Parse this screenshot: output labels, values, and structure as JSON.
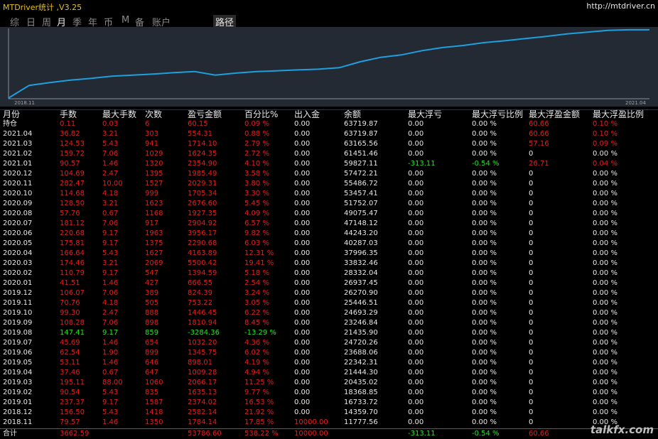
{
  "titlebar": {
    "title": "MTDriver统计 ,V3.25",
    "url": "http://mtdriver.cn"
  },
  "tabs": [
    {
      "label": "综",
      "active": false
    },
    {
      "label": "日",
      "active": false
    },
    {
      "label": "周",
      "active": false
    },
    {
      "label": "月",
      "active": true
    },
    {
      "label": "季",
      "active": false
    },
    {
      "label": "年",
      "active": false
    },
    {
      "label": "币",
      "active": false
    },
    {
      "label": "M",
      "active": false
    },
    {
      "label": "备",
      "active": false
    },
    {
      "label": "账户",
      "active": false
    }
  ],
  "path_tab": "路径",
  "chart_data": {
    "type": "line",
    "x_start_label": "2018.11",
    "x_end_label": "2021.04",
    "line_color": "#1ea0e0",
    "series": [
      {
        "values": [
          0,
          11777.56,
          14359.7,
          16733.72,
          18368.85,
          20435.02,
          21444.3,
          22342.31,
          23688.06,
          24720.26,
          21435.9,
          23246.84,
          24693.29,
          25446.51,
          26270.9,
          26937.45,
          28332.04,
          33832.46,
          37996.35,
          40287.03,
          44243.2,
          47148.12,
          49075.47,
          51752.07,
          53457.41,
          55486.72,
          57472.21,
          59827.11,
          61451.46,
          63165.56,
          63719.87,
          63719.87
        ]
      }
    ]
  },
  "table": {
    "headers": [
      "月份",
      "手数",
      "最大手数",
      "次数",
      "盈亏金额",
      "百分比%",
      "出入金",
      "余额",
      "最大浮亏",
      "最大浮亏比例",
      "最大浮盈金额",
      "最大浮盈比例"
    ],
    "rows": [
      [
        "持仓",
        "0.11",
        "0.03",
        "6",
        "60.15",
        "0.09 %",
        "0.00",
        "63719.87",
        "0.00",
        "0.00 %",
        "60.66",
        "0.10 %"
      ],
      [
        "2021.04",
        "36.82",
        "3.21",
        "303",
        "554.31",
        "0.88 %",
        "0.00",
        "63719.87",
        "0.00",
        "0.00 %",
        "60.66",
        "0.10 %"
      ],
      [
        "2021.03",
        "124.53",
        "5.43",
        "941",
        "1714.10",
        "2.79 %",
        "0.00",
        "63165.56",
        "0.00",
        "0.00 %",
        "57.16",
        "0.09 %"
      ],
      [
        "2021.02",
        "159.72",
        "7.06",
        "1029",
        "1624.35",
        "2.72 %",
        "0.00",
        "61451.46",
        "0.00",
        "0.00 %",
        "0",
        "0.00 %"
      ],
      [
        "2021.01",
        "90.57",
        "1.46",
        "1320",
        "2354.90",
        "4.10 %",
        "0.00",
        "59827.11",
        "-313.11",
        "-0.54 %",
        "26.71",
        "0.04 %"
      ],
      [
        "2020.12",
        "104.69",
        "2.47",
        "1395",
        "1985.49",
        "3.58 %",
        "0.00",
        "57472.21",
        "0.00",
        "0.00 %",
        "0",
        "0.00 %"
      ],
      [
        "2020.11",
        "282.47",
        "10.00",
        "1527",
        "2029.31",
        "3.80 %",
        "0.00",
        "55486.72",
        "0.00",
        "0.00 %",
        "0",
        "0.00 %"
      ],
      [
        "2020.10",
        "114.68",
        "4.18",
        "999",
        "1705.34",
        "3.30 %",
        "0.00",
        "53457.41",
        "0.00",
        "0.00 %",
        "0",
        "0.00 %"
      ],
      [
        "2020.09",
        "128.50",
        "3.21",
        "1623",
        "2676.60",
        "5.45 %",
        "0.00",
        "51752.07",
        "0.00",
        "0.00 %",
        "0",
        "0.00 %"
      ],
      [
        "2020.08",
        "57.76",
        "0.67",
        "1168",
        "1927.35",
        "4.09 %",
        "0.00",
        "49075.47",
        "0.00",
        "0.00 %",
        "0",
        "0.00 %"
      ],
      [
        "2020.07",
        "181.12",
        "7.06",
        "917",
        "2904.92",
        "6.57 %",
        "0.00",
        "47148.12",
        "0.00",
        "0.00 %",
        "0",
        "0.00 %"
      ],
      [
        "2020.06",
        "220.68",
        "9.17",
        "1963",
        "3956.17",
        "9.82 %",
        "0.00",
        "44243.20",
        "0.00",
        "0.00 %",
        "0",
        "0.00 %"
      ],
      [
        "2020.05",
        "175.81",
        "9.17",
        "1375",
        "2290.68",
        "6.03 %",
        "0.00",
        "40287.03",
        "0.00",
        "0.00 %",
        "0",
        "0.00 %"
      ],
      [
        "2020.04",
        "166.64",
        "5.43",
        "1627",
        "4163.89",
        "12.31 %",
        "0.00",
        "37996.35",
        "0.00",
        "0.00 %",
        "0",
        "0.00 %"
      ],
      [
        "2020.03",
        "174.46",
        "3.21",
        "2069",
        "5500.42",
        "19.41 %",
        "0.00",
        "33832.46",
        "0.00",
        "0.00 %",
        "0",
        "0.00 %"
      ],
      [
        "2020.02",
        "110.79",
        "9.17",
        "547",
        "1394.59",
        "5.18 %",
        "0.00",
        "28332.04",
        "0.00",
        "0.00 %",
        "0",
        "0.00 %"
      ],
      [
        "2020.01",
        "41.51",
        "1.46",
        "427",
        "666.55",
        "2.54 %",
        "0.00",
        "26937.45",
        "0.00",
        "0.00 %",
        "0",
        "0.00 %"
      ],
      [
        "2019.12",
        "106.07",
        "7.06",
        "389",
        "824.39",
        "3.24 %",
        "0.00",
        "26270.90",
        "0.00",
        "0.00 %",
        "0",
        "0.00 %"
      ],
      [
        "2019.11",
        "70.76",
        "4.18",
        "505",
        "753.22",
        "3.05 %",
        "0.00",
        "25446.51",
        "0.00",
        "0.00 %",
        "0",
        "0.00 %"
      ],
      [
        "2019.10",
        "99.30",
        "2.47",
        "888",
        "1446.45",
        "6.22 %",
        "0.00",
        "24693.29",
        "0.00",
        "0.00 %",
        "0",
        "0.00 %"
      ],
      [
        "2019.09",
        "108.28",
        "7.06",
        "898",
        "1810.94",
        "8.45 %",
        "0.00",
        "23246.84",
        "0.00",
        "0.00 %",
        "0",
        "0.00 %"
      ],
      [
        "2019.08",
        "147.41",
        "9.17",
        "859",
        "-3284.36",
        "-13.29 %",
        "0.00",
        "21435.90",
        "0.00",
        "0.00 %",
        "0",
        "0.00 %"
      ],
      [
        "2019.07",
        "45.69",
        "1.46",
        "654",
        "1032.20",
        "4.36 %",
        "0.00",
        "24720.26",
        "0.00",
        "0.00 %",
        "0",
        "0.00 %"
      ],
      [
        "2019.06",
        "62.54",
        "1.90",
        "899",
        "1345.75",
        "6.02 %",
        "0.00",
        "23688.06",
        "0.00",
        "0.00 %",
        "0",
        "0.00 %"
      ],
      [
        "2019.05",
        "53.11",
        "1.46",
        "646",
        "898.01",
        "4.19 %",
        "0.00",
        "22342.31",
        "0.00",
        "0.00 %",
        "0",
        "0.00 %"
      ],
      [
        "2019.04",
        "37.46",
        "0.67",
        "647",
        "1009.28",
        "4.94 %",
        "0.00",
        "21444.30",
        "0.00",
        "0.00 %",
        "0",
        "0.00 %"
      ],
      [
        "2019.03",
        "195.11",
        "88.00",
        "1060",
        "2066.17",
        "11.25 %",
        "0.00",
        "20435.02",
        "0.00",
        "0.00 %",
        "0",
        "0.00 %"
      ],
      [
        "2019.02",
        "90.54",
        "5.43",
        "835",
        "1635.13",
        "9.77 %",
        "0.00",
        "18368.85",
        "0.00",
        "0.00 %",
        "0",
        "0.00 %"
      ],
      [
        "2019.01",
        "237.37",
        "9.17",
        "1587",
        "2374.02",
        "16.53 %",
        "0.00",
        "16733.72",
        "0.00",
        "0.00 %",
        "0",
        "0.00 %"
      ],
      [
        "2018.12",
        "156.50",
        "5.43",
        "1418",
        "2582.14",
        "21.92 %",
        "0.00",
        "14359.70",
        "0.00",
        "0.00 %",
        "0",
        "0.00 %"
      ],
      [
        "2018.11",
        "79.57",
        "1.46",
        "1350",
        "1784.14",
        "17.85 %",
        "10000.00",
        "11777.56",
        "0.00",
        "0.00 %",
        "0",
        "0.00 %"
      ]
    ],
    "total": [
      "合计",
      "3662.59",
      "",
      "",
      "53786.60",
      "538.22 %",
      "10000.00",
      "",
      "-313.11",
      "-0.54 %",
      "60.66",
      ""
    ]
  },
  "watermark": "talkfx.com",
  "colors": {
    "gain": "#e02020",
    "loss": "#28e028",
    "neutral": "#e8e8e8",
    "title": "#e8c020"
  }
}
